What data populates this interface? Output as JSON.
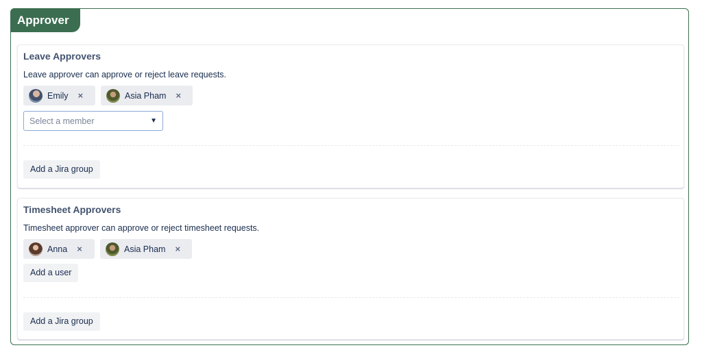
{
  "section": {
    "title": "Approver"
  },
  "leave": {
    "title": "Leave Approvers",
    "description": "Leave approver can approve or reject leave requests.",
    "approvers": [
      {
        "name": "Emily",
        "avatar": "avatar-photo-emily"
      },
      {
        "name": "Asia Pham",
        "avatar": "avatar-photo-asia-pham"
      }
    ],
    "member_select": {
      "placeholder": "Select a member",
      "chevron": "chevron-down-icon"
    },
    "add_group_label": "Add a Jira group"
  },
  "timesheet": {
    "title": "Timesheet Approvers",
    "description": "Timesheet approver can approve or reject timesheet requests.",
    "approvers": [
      {
        "name": "Anna",
        "avatar": "avatar-photo-anna"
      },
      {
        "name": "Asia Pham",
        "avatar": "avatar-photo-asia-pham"
      }
    ],
    "add_user_label": "Add a user",
    "add_group_label": "Add a Jira group"
  },
  "icons": {
    "remove": "×",
    "chevron": "⌄"
  },
  "colors": {
    "accent": "#3b6e50",
    "chip_bg": "#ebecf0",
    "select_border": "#8aa8d8"
  }
}
